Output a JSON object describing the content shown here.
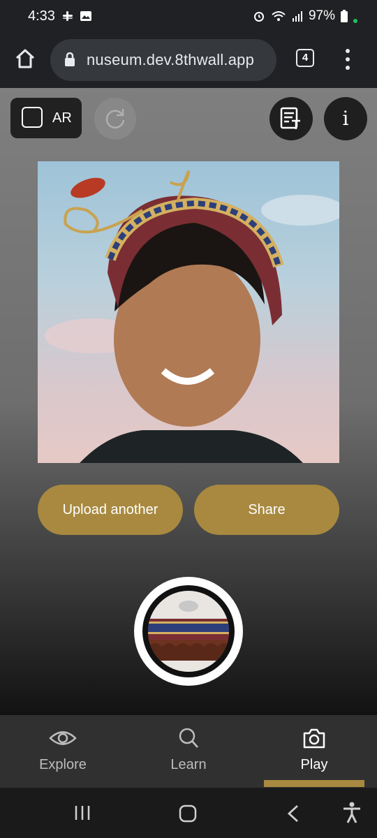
{
  "status_bar": {
    "time": "4:33",
    "battery": "97%"
  },
  "browser": {
    "url": "nuseum.dev.8thwall.app",
    "tab_count": "4"
  },
  "toolbar": {
    "ar_label": "AR",
    "info_label": "i"
  },
  "actions": {
    "upload_label": "Upload another",
    "share_label": "Share"
  },
  "nav": {
    "items": [
      {
        "label": "Explore",
        "icon": "eye-icon"
      },
      {
        "label": "Learn",
        "icon": "search-icon"
      },
      {
        "label": "Play",
        "icon": "camera-icon"
      }
    ],
    "active_index": 2
  },
  "colors": {
    "accent": "#a8893f"
  }
}
